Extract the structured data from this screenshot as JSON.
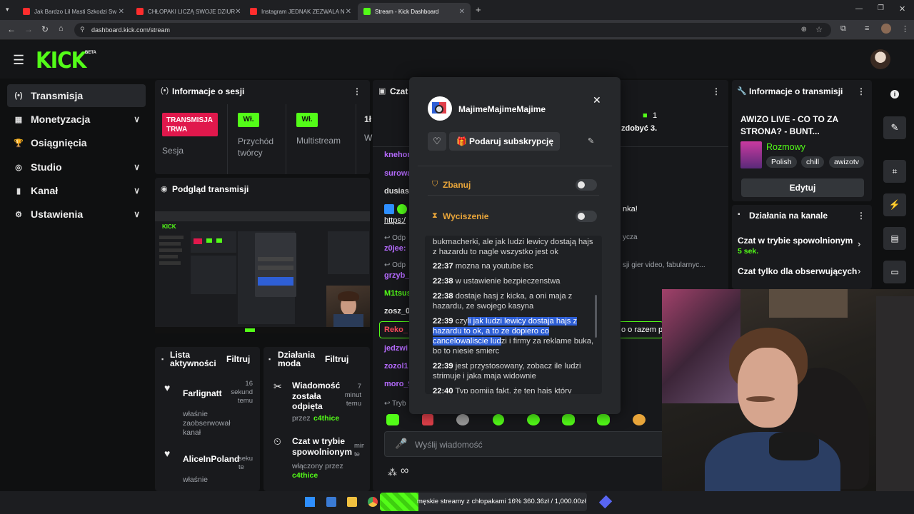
{
  "browser": {
    "tabs": [
      {
        "title": "Jak Bardzo Lil Masti Szkodzi Sw",
        "fav_color": "#ff2d2d"
      },
      {
        "title": "CHŁOPAKI LICZĄ SWOJE DZIUR",
        "fav_color": "#ff2d2d"
      },
      {
        "title": "Instagram JEDNAK ZEZWALA N",
        "fav_color": "#ff2d2d"
      },
      {
        "title": "Stream - Kick Dashboard",
        "fav_color": "#53fc18"
      }
    ],
    "url": "dashboard.kick.com/stream"
  },
  "brand": {
    "logo": "KICK",
    "beta": "BETA",
    "accent": "#53fc18"
  },
  "sidebar": {
    "items": [
      {
        "label": "Transmisja",
        "icon": "broadcast-icon",
        "glyph": "(•)",
        "chev": ""
      },
      {
        "label": "Monetyzacja",
        "icon": "money-icon",
        "glyph": "▦",
        "chev": "∨"
      },
      {
        "label": "Osiągnięcia",
        "icon": "trophy-icon",
        "glyph": "🏆",
        "chev": ""
      },
      {
        "label": "Studio",
        "icon": "studio-icon",
        "glyph": "◎",
        "chev": "∨"
      },
      {
        "label": "Kanał",
        "icon": "channel-icon",
        "glyph": "▮",
        "chev": "∨"
      },
      {
        "label": "Ustawienia",
        "icon": "settings-icon",
        "glyph": "⚙",
        "chev": "∨"
      }
    ]
  },
  "session": {
    "title": "Informacje o sesji",
    "status_badge": "TRANSMISJA TRWA",
    "status_label": "Sesja",
    "creator_badge": "Wł.",
    "creator_label": "Przychód twórcy",
    "multistream_badge": "Wł.",
    "multistream_label": "Multistream",
    "partial_num": "1ł",
    "partial_w": "W"
  },
  "preview": {
    "title": "Podgląd transmisji",
    "mini_logo": "KICK"
  },
  "activity": {
    "title": "Lista aktywności",
    "filter": "Filtruj",
    "entries": [
      {
        "name": "Farlignatt",
        "time": "16 sekund temu",
        "desc": "właśnie zaobserwował kanał"
      },
      {
        "name": "AliceInPoland",
        "time": "seku te",
        "desc": "właśnie"
      }
    ]
  },
  "modactions": {
    "title": "Działania moda",
    "filter": "Filtruj",
    "entries": [
      {
        "title": "Wiadomość została odpięta",
        "time": "7 minut temu",
        "by": "przez",
        "mod": "c4thice"
      },
      {
        "title": "Czat w trybie spowolnionym",
        "time": "min te",
        "by": "włączony przez",
        "mod": "c4thice"
      }
    ]
  },
  "chat": {
    "title": "Czat",
    "names": [
      {
        "name": "knehor",
        "color": "#b66bff"
      },
      {
        "name": "surowa",
        "color": "#b66bff"
      },
      {
        "name": "dusias",
        "color": "#e0e0e0"
      },
      {
        "name": "z0jee:",
        "color": "#b66bff"
      },
      {
        "name": "grzyb_",
        "color": "#b66bff"
      },
      {
        "name": "M1tsus",
        "color": "#53fc18"
      },
      {
        "name": "zosz_0",
        "color": "#e0e0e0"
      },
      {
        "name": "Reko_",
        "color": "#ff4b5c"
      },
      {
        "name": "jedzwi",
        "color": "#b66bff"
      },
      {
        "name": "zozol1",
        "color": "#b66bff"
      },
      {
        "name": "moro_9",
        "color": "#b66bff"
      }
    ],
    "link_partial": "https:/",
    "reply_partial1": "Odp",
    "reply_partial2": "Odp",
    "count": "1",
    "right_text1": "zdobyć 3.",
    "right_text2": "nka!",
    "right_text3": "ycza",
    "right_text4": "sji gier video, fabularnyc...",
    "right_text5": "o o razem p",
    "mode_partial": "Tryb",
    "input_placeholder": "Wyślij wiadomość",
    "bottom_icon": "∞"
  },
  "usercard": {
    "username": "MajimeMajimeMajime",
    "gift_label": "Podaruj subskrypcję",
    "ban_label": "Zbanuj",
    "timeout_label": "Wyciszenie",
    "messages": [
      {
        "time": "",
        "text": "bukmacherki, ale jak ludzi lewicy dostają hajs z hazardu to nagle wszystko jest ok"
      },
      {
        "time": "22:37",
        "text": "mozna na youtube isc"
      },
      {
        "time": "22:38",
        "text": "w ustawienie bezpieczenstwa"
      },
      {
        "time": "22:38",
        "text": "dostaje hasj z kicka, a oni maja z hazardu, ze swojego kasyna"
      },
      {
        "time": "22:39",
        "text_pre": "czy",
        "text_hl": "li jak ludzi lewicy dostaja hajs z hazardu to ok, a to ze dopiero co cancelowaliscie lud",
        "text_post": "zi i firmy za reklame buka, bo to niesie smierc"
      },
      {
        "time": "22:39",
        "text": "jest przystosowany, zobacz ile ludzi strimuje i jaka maja widownie"
      },
      {
        "time": "22:40",
        "text": "Typ pomija fakt, że ten hajs który"
      }
    ]
  },
  "streaminfo": {
    "title": "Informacje o transmisji",
    "stream_title": "AWIZO LIVE - CO TO ZA STRONA? - BUNT...",
    "category": "Rozmowy",
    "tags": [
      "Polish",
      "chill",
      "awizotv"
    ],
    "edit": "Edytuj"
  },
  "channelactions": {
    "title": "Działania na kanale",
    "items": [
      {
        "label": "Czat w trybie spowolnionym",
        "sub": "5 sek."
      },
      {
        "label": "Czat tylko dla obserwujących",
        "sub": ""
      }
    ]
  },
  "taskbar": {
    "media_text": "męskie streamy z chłopakami 16% 360.36zł / 1,000.00zł"
  }
}
